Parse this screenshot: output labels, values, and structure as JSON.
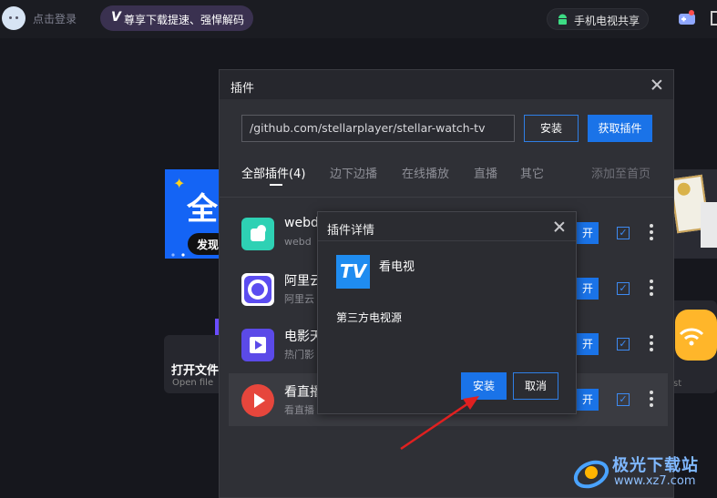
{
  "topbar": {
    "login_label": "点击登录",
    "vip_text": "尊享下载提速、强悍解码",
    "tv_share_label": "手机电视共享"
  },
  "background": {
    "banner_char": "全",
    "banner_button": "发现",
    "open_file_title": "打开文件",
    "open_file_subtitle": "Open file",
    "right_card_partial": "st"
  },
  "plugin_dialog": {
    "title": "插件",
    "url_value": "/github.com/stellarplayer/stellar-watch-tv",
    "install_label": "安装",
    "get_plugin_label": "获取插件",
    "tabs": [
      {
        "label": "全部插件(4)",
        "active": true
      },
      {
        "label": "边下边播",
        "active": false
      },
      {
        "label": "在线播放",
        "active": false
      },
      {
        "label": "直播",
        "active": false
      },
      {
        "label": "其它",
        "active": false
      }
    ],
    "add_home_label": "添加至首页",
    "rows": [
      {
        "name": "webd",
        "desc": "webd",
        "button": "开",
        "checked": true,
        "icon": "webdav-icon",
        "color": "#2ed1b4"
      },
      {
        "name": "阿里云",
        "desc": "阿里云",
        "button": "开",
        "checked": true,
        "icon": "aliyun-icon",
        "color": "#ffffff"
      },
      {
        "name": "电影天",
        "desc": "热门影",
        "button": "开",
        "checked": true,
        "icon": "movie-play-icon",
        "color": "#5b4ae8"
      },
      {
        "name": "看直播",
        "desc": "看直播",
        "button": "开",
        "checked": true,
        "icon": "live-play-icon",
        "color": "#e6463c"
      }
    ]
  },
  "detail_dialog": {
    "title": "插件详情",
    "logo_text": "TV",
    "plugin_name": "看电视",
    "description": "第三方电视源",
    "install_label": "安装",
    "cancel_label": "取消"
  },
  "watermark": {
    "name": "极光下载站",
    "url": "www.xz7.com"
  },
  "colors": {
    "accent": "#1a73e8",
    "background": "#16171d",
    "dialog": "#2f3036",
    "annotation_arrow": "#e02020"
  }
}
